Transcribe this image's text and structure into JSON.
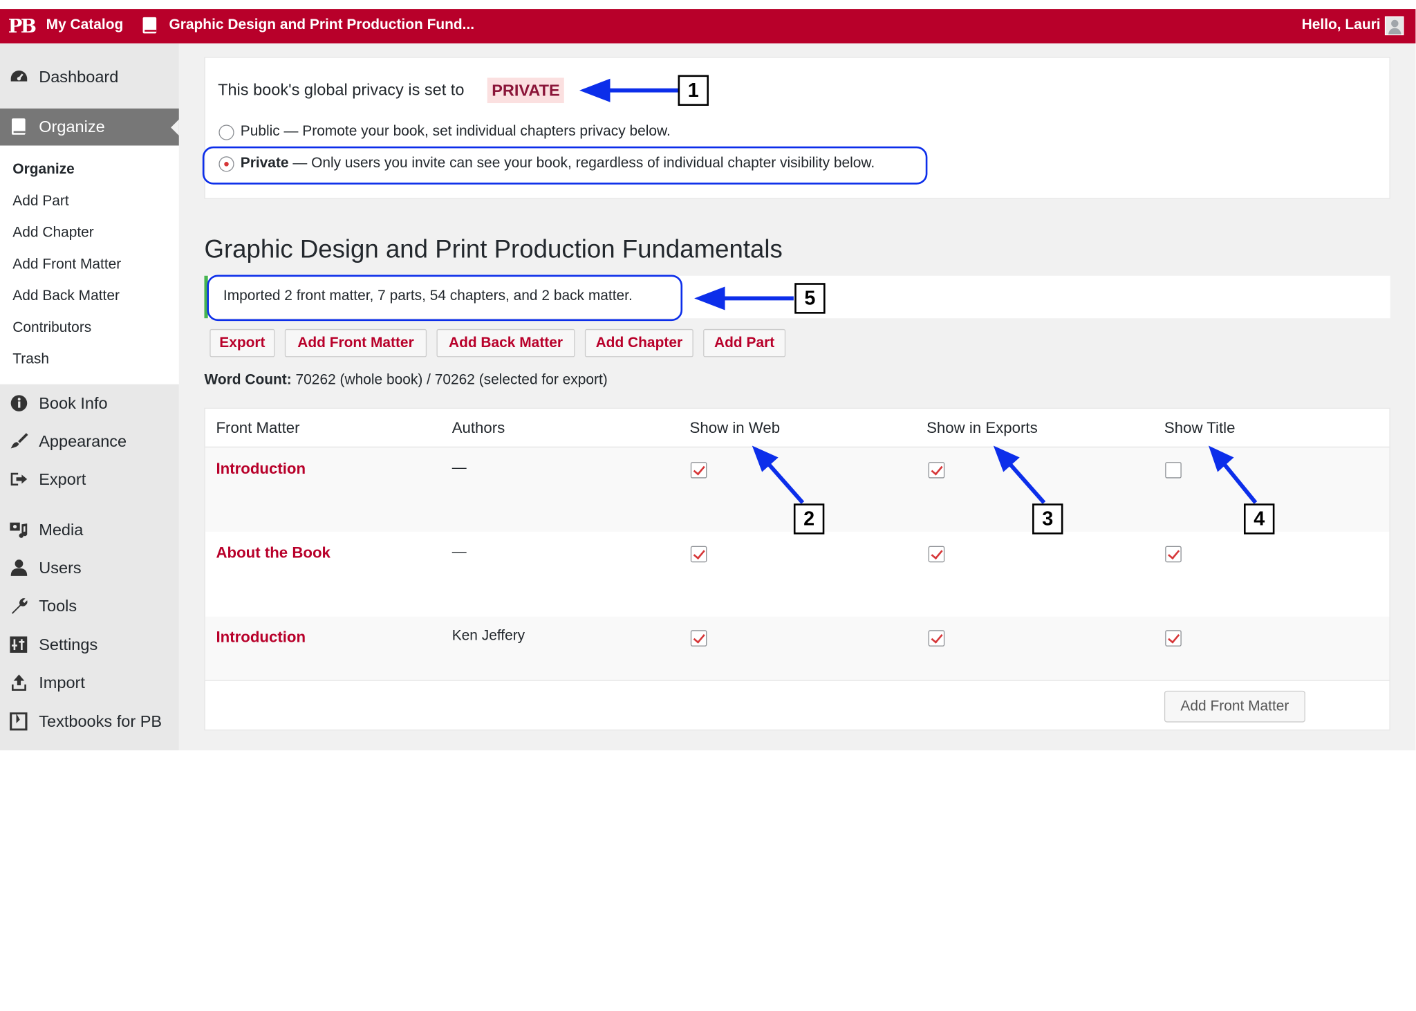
{
  "topbar": {
    "logo": "PB",
    "catalog": "My Catalog",
    "book_title": "Graphic Design and Print Production Fund...",
    "greeting": "Hello, Lauri"
  },
  "sidebar": {
    "items": [
      {
        "label": "Dashboard",
        "icon": "dashboard-icon"
      },
      {
        "label": "Organize",
        "icon": "book-icon"
      },
      {
        "label": "Book Info",
        "icon": "info-icon"
      },
      {
        "label": "Appearance",
        "icon": "brush-icon"
      },
      {
        "label": "Export",
        "icon": "export-icon"
      },
      {
        "label": "Media",
        "icon": "media-icon"
      },
      {
        "label": "Users",
        "icon": "user-icon"
      },
      {
        "label": "Tools",
        "icon": "wrench-icon"
      },
      {
        "label": "Settings",
        "icon": "settings-icon"
      },
      {
        "label": "Import",
        "icon": "upload-icon"
      },
      {
        "label": "Textbooks for PB",
        "icon": "textbooks-icon"
      }
    ],
    "submenu": [
      "Organize",
      "Add Part",
      "Add Chapter",
      "Add Front Matter",
      "Add Back Matter",
      "Contributors",
      "Trash"
    ]
  },
  "privacy": {
    "text": "This book's global privacy is set to",
    "badge": "PRIVATE",
    "public_label": "Public",
    "public_desc": " — Promote your book, set individual chapters privacy below.",
    "private_label": "Private",
    "private_desc": " — Only users you invite can see your book, regardless of individual chapter visibility below.",
    "selected": "private"
  },
  "book": {
    "title": "Graphic Design and Print Production Fundamentals",
    "notice": "Imported 2 front matter, 7 parts, 54 chapters, and 2 back matter."
  },
  "actions": [
    "Export",
    "Add Front Matter",
    "Add Back Matter",
    "Add Chapter",
    "Add Part"
  ],
  "wordcount": {
    "label": "Word Count:",
    "value": "70262 (whole book) / 70262 (selected for export)"
  },
  "table": {
    "headers": [
      "Front Matter",
      "Authors",
      "Show in Web",
      "Show in Exports",
      "Show Title"
    ],
    "rows": [
      {
        "title": "Introduction",
        "author": "—",
        "web": true,
        "exports": true,
        "show_title": false
      },
      {
        "title": "About the Book",
        "author": "—",
        "web": true,
        "exports": true,
        "show_title": true
      },
      {
        "title": "Introduction",
        "author": "Ken Jeffery",
        "web": true,
        "exports": true,
        "show_title": true
      }
    ],
    "footer_button": "Add Front Matter"
  },
  "callouts": [
    "1",
    "2",
    "3",
    "4",
    "5"
  ],
  "colors": {
    "brand": "#b8002a",
    "callout_blue": "#0c2eea",
    "notice_green": "#46b450"
  }
}
